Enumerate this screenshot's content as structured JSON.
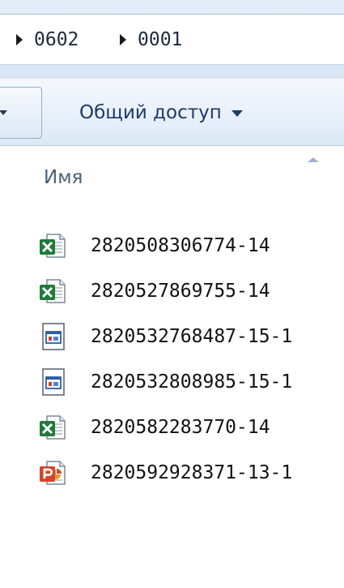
{
  "address": {
    "crumbs": [
      "0602",
      "0001"
    ]
  },
  "toolbar": {
    "share_label": "Общий доступ"
  },
  "columns": {
    "name_label": "Имя"
  },
  "files": [
    {
      "name": "2820508306774-14",
      "icon": "excel-file-icon"
    },
    {
      "name": "2820527869755-14",
      "icon": "excel-file-icon"
    },
    {
      "name": "2820532768487-15-1",
      "icon": "application-file-icon"
    },
    {
      "name": "2820532808985-15-1",
      "icon": "application-file-icon"
    },
    {
      "name": "2820582283770-14",
      "icon": "excel-file-icon"
    },
    {
      "name": "2820592928371-13-1",
      "icon": "powerpoint-file-icon"
    }
  ],
  "colors": {
    "accent": "#1e3a66",
    "excel": "#1e7b3a",
    "powerpoint": "#d24726"
  }
}
